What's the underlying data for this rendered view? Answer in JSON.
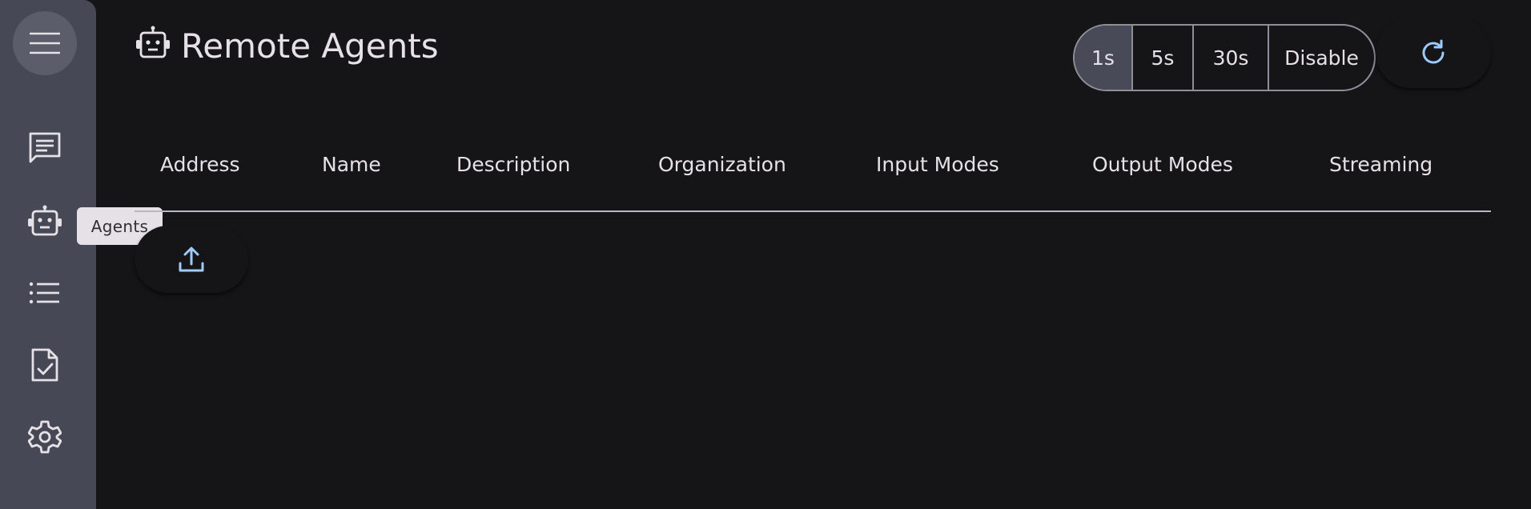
{
  "sidebar": {
    "items": [
      {
        "name": "menu",
        "icon": "menu-icon"
      },
      {
        "name": "chat",
        "icon": "chat-icon"
      },
      {
        "name": "agents",
        "icon": "robot-icon",
        "tooltip": "Agents"
      },
      {
        "name": "tasks",
        "icon": "list-icon"
      },
      {
        "name": "events",
        "icon": "document-check-icon"
      },
      {
        "name": "settings",
        "icon": "gear-icon"
      }
    ]
  },
  "header": {
    "icon": "robot-icon",
    "title": "Remote Agents"
  },
  "poll_interval": {
    "options": [
      "1s",
      "5s",
      "30s",
      "Disable"
    ],
    "selected": "1s"
  },
  "refresh": {
    "icon": "refresh-icon"
  },
  "table": {
    "columns": [
      "Address",
      "Name",
      "Description",
      "Organization",
      "Input Modes",
      "Output Modes",
      "Streaming"
    ],
    "rows": []
  },
  "upload": {
    "icon": "upload-icon"
  },
  "colors": {
    "background": "#151517",
    "sidebar": "#474855",
    "accent": "#9ecaff",
    "text": "#e6e1e6",
    "selected_toggle": "#484a58"
  }
}
